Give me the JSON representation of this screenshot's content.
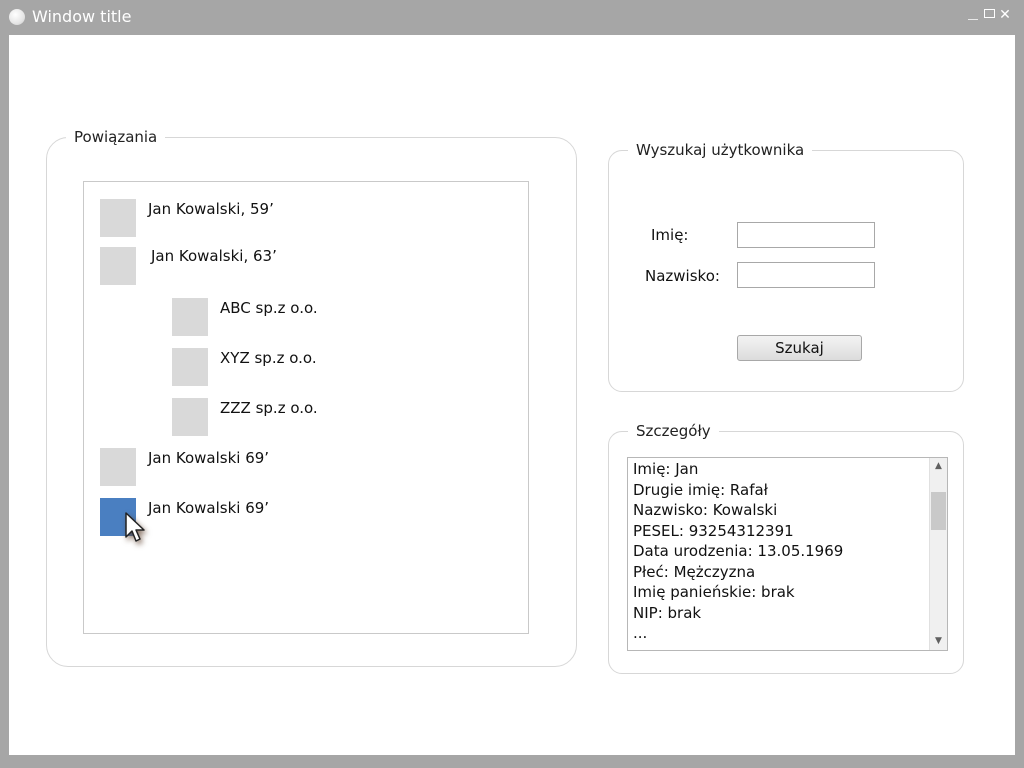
{
  "window": {
    "title": "Window title",
    "close_glyph": "✕"
  },
  "relations": {
    "legend": "Powiązania",
    "nodes": [
      {
        "label": "Jan Kowalski, 59’",
        "level": 0,
        "selected": false
      },
      {
        "label": "Jan Kowalski, 63’",
        "level": 0,
        "selected": false
      },
      {
        "label": "ABC sp.z o.o.",
        "level": 1,
        "selected": false
      },
      {
        "label": "XYZ sp.z o.o.",
        "level": 1,
        "selected": false
      },
      {
        "label": "ZZZ sp.z o.o.",
        "level": 1,
        "selected": false
      },
      {
        "label": "Jan Kowalski 69’",
        "level": 0,
        "selected": false
      },
      {
        "label": "Jan Kowalski 69’",
        "level": 0,
        "selected": true
      }
    ]
  },
  "search": {
    "legend": "Wyszukaj użytkownika",
    "first_name_label": "Imię:",
    "first_name_value": "",
    "last_name_label": "Nazwisko:",
    "last_name_value": "",
    "button_label": "Szukaj"
  },
  "details": {
    "legend": "Szczegóły",
    "lines": [
      "Imię: Jan",
      "Drugie imię: Rafał",
      "Nazwisko: Kowalski",
      "PESEL: 93254312391",
      "Data urodzenia: 13.05.1969",
      "Płeć: Mężczyzna",
      "Imię panieńskie: brak",
      "NIP: brak",
      "..."
    ]
  },
  "colors": {
    "chrome": "#a6a6a6",
    "node_box": "#d9d9d9",
    "selected_node": "#4a7fc1"
  },
  "icons": {
    "app": "app-icon",
    "minimize": "minimize-icon",
    "maximize": "maximize-icon",
    "close": "close-icon",
    "cursor": "mouse-cursor-icon",
    "scroll_up": "scroll-up-arrow-icon",
    "scroll_down": "scroll-down-arrow-icon"
  }
}
